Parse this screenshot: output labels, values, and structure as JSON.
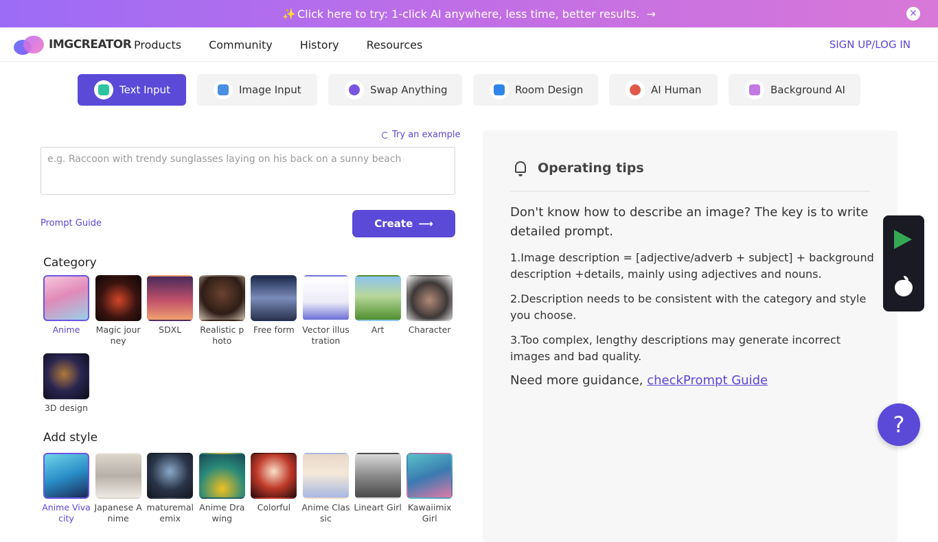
{
  "promo": {
    "text": "Click here to try: 1-click AI anywhere, less time, better results.",
    "sparkle": "✨",
    "arrow": "→",
    "close": "✕"
  },
  "header": {
    "logo_text": "IMGCREATOR",
    "nav": [
      "Products",
      "Community",
      "History",
      "Resources"
    ],
    "signup": "SIGN UP/LOG IN"
  },
  "tabs": [
    {
      "label": "Text Input",
      "icon": "text-input-icon",
      "color": "#2ec4a0"
    },
    {
      "label": "Image Input",
      "icon": "image-icon",
      "color": "#4a8fe0"
    },
    {
      "label": "Swap Anything",
      "icon": "palette-icon",
      "color": "#7a55e0"
    },
    {
      "label": "Room Design",
      "icon": "house-icon",
      "color": "#2f86e8"
    },
    {
      "label": "AI Human",
      "icon": "face-icon",
      "color": "#e05a4a"
    },
    {
      "label": "Background AI",
      "icon": "mountain-icon",
      "color": "#c07ae0"
    }
  ],
  "input": {
    "try_example": "Try an example",
    "placeholder": "e.g. Raccoon with trendy sunglasses laying on his back on a sunny beach",
    "value": "",
    "prompt_guide": "Prompt Guide",
    "create": "Create",
    "create_arrow": "⟶"
  },
  "category": {
    "title": "Category",
    "items": [
      {
        "label": "Anime",
        "selected": true
      },
      {
        "label": "Magic journey"
      },
      {
        "label": "SDXL"
      },
      {
        "label": "Realistic photo"
      },
      {
        "label": "Free form"
      },
      {
        "label": "Vector illustration"
      },
      {
        "label": "Art"
      },
      {
        "label": "Character"
      },
      {
        "label": "3D design"
      }
    ]
  },
  "style": {
    "title": "Add style",
    "items": [
      {
        "label": "Anime Vivacity",
        "selected": true
      },
      {
        "label": "Japanese Anime"
      },
      {
        "label": "maturemalemix"
      },
      {
        "label": "Anime Drawing"
      },
      {
        "label": "Colorful"
      },
      {
        "label": "Anime Classic"
      },
      {
        "label": "Lineart Girl"
      },
      {
        "label": "Kawaiimix Girl"
      }
    ]
  },
  "tips": {
    "title": "Operating tips",
    "lead": "Don't know how to describe an image? The key is to write detailed prompt.",
    "items": [
      "1.Image description = [adjective/adverb + subject] + background description +details, mainly using adjectives and nouns.",
      "2.Description needs to be consistent with the category and style you choose.",
      "3.Too complex, lengthy descriptions may generate incorrect images and bad quality."
    ],
    "more_prefix": "Need more guidance, ",
    "more_link": "checkPrompt Guide"
  },
  "help": "?",
  "colors": {
    "accent": "#5b49d8",
    "banner_start": "#9c6cf6",
    "banner_end": "#d878d8"
  }
}
